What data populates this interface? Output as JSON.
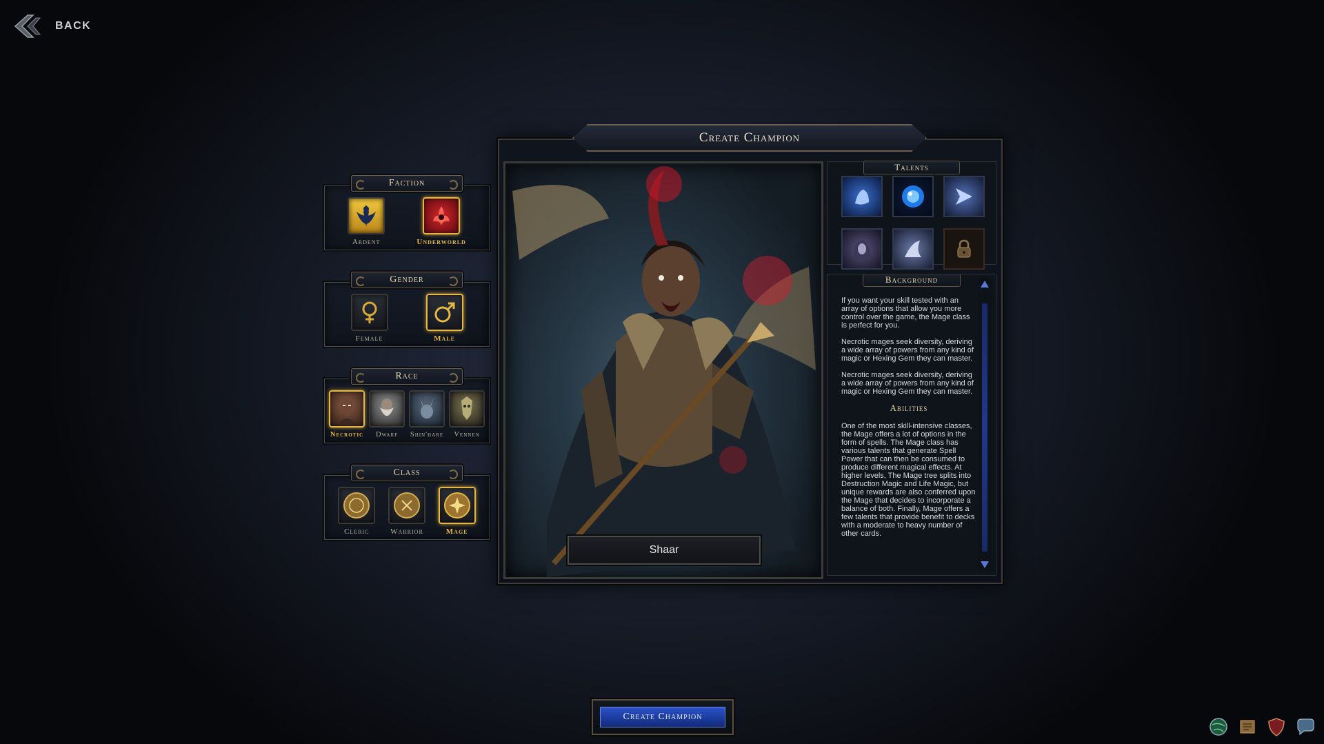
{
  "nav": {
    "back_label": "BACK"
  },
  "title": "Create Champion",
  "faction": {
    "title": "Faction",
    "options": [
      {
        "label": "Ardent",
        "icon": "ardent-crest-icon",
        "selected": false
      },
      {
        "label": "Underworld",
        "icon": "underworld-flame-icon",
        "selected": true
      }
    ]
  },
  "gender": {
    "title": "Gender",
    "options": [
      {
        "label": "Female",
        "icon": "female-symbol-icon",
        "selected": false
      },
      {
        "label": "Male",
        "icon": "male-symbol-icon",
        "selected": true
      }
    ]
  },
  "race": {
    "title": "Race",
    "options": [
      {
        "label": "Necrotic",
        "icon": "necrotic-portrait-icon",
        "selected": true
      },
      {
        "label": "Dwarf",
        "icon": "dwarf-portrait-icon",
        "selected": false
      },
      {
        "label": "Shin'hare",
        "icon": "shinhare-portrait-icon",
        "selected": false
      },
      {
        "label": "Vennen",
        "icon": "vennen-portrait-icon",
        "selected": false
      }
    ]
  },
  "class": {
    "title": "Class",
    "options": [
      {
        "label": "Cleric",
        "icon": "cleric-medallion-icon",
        "selected": false
      },
      {
        "label": "Warrior",
        "icon": "warrior-medallion-icon",
        "selected": false
      },
      {
        "label": "Mage",
        "icon": "mage-medallion-icon",
        "selected": true
      }
    ]
  },
  "champion_name": "Shaar",
  "talents": {
    "title": "Talents",
    "icons": [
      "frost-hand-icon",
      "arcane-orb-icon",
      "spectral-mage-icon",
      "hooded-figure-icon",
      "caster-silhouette-icon",
      "padlock-icon"
    ]
  },
  "background": {
    "title": "Background",
    "paragraphs": [
      "If you want your skill tested with an array of options that allow you more control over the game, the Mage class is perfect for you.",
      "Necrotic mages seek diversity, deriving a wide array of powers from any kind of magic or Hexing Gem they can master.",
      "Necrotic mages seek diversity, deriving a wide array of powers from any kind of magic or Hexing Gem they can master."
    ]
  },
  "abilities": {
    "title": "Abilities",
    "text": "One of the most skill-intensive classes, the Mage offers a lot of options in the form of spells. The Mage class has various talents that generate Spell Power that can then be consumed to produce different magical effects. At higher levels, The Mage tree splits into Destruction Magic and Life Magic, but unique rewards are also conferred upon the Mage that decides to incorporate a balance of both. Finally, Mage offers a few talents that provide benefit to decks with a moderate to heavy number of other cards."
  },
  "create_button_label": "Create Champion",
  "system_icons": [
    "globe-icon",
    "map-scroll-icon",
    "shield-crest-icon",
    "chat-bubble-icon"
  ],
  "colors": {
    "accent_gold": "#e4b843",
    "button_blue": "#2d52c8"
  }
}
